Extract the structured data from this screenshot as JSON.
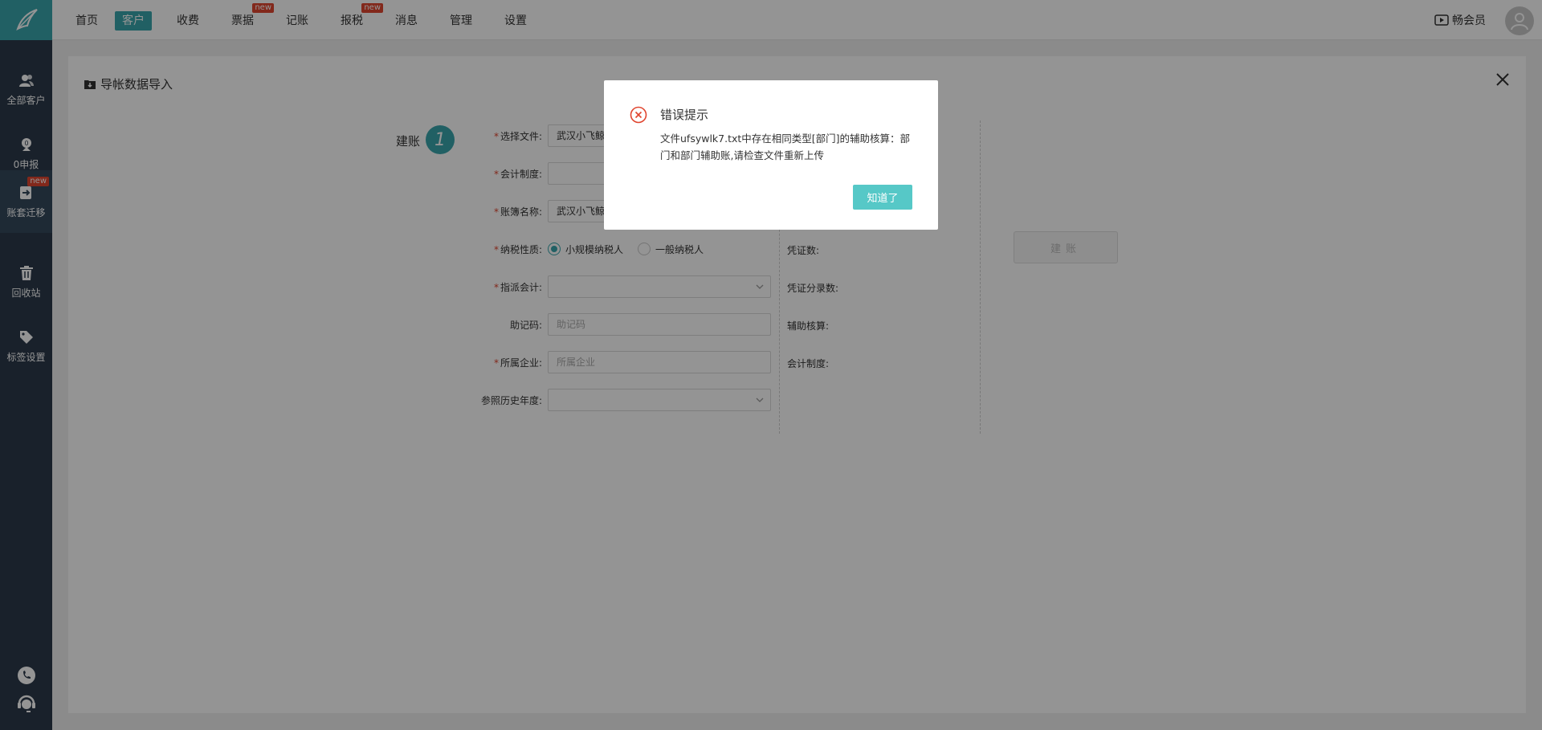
{
  "sidebar": {
    "items": [
      {
        "label": "全部客户",
        "icon": "users-icon"
      },
      {
        "label": "0申报",
        "icon": "zero-report-icon"
      },
      {
        "label": "账套迁移",
        "icon": "migrate-icon",
        "badge": "new",
        "active": true
      },
      {
        "label": "回收站",
        "icon": "trash-icon"
      },
      {
        "label": "标签设置",
        "icon": "tag-icon"
      }
    ]
  },
  "topnav": {
    "items": [
      {
        "label": "首页"
      },
      {
        "label": "客户",
        "active": true
      },
      {
        "label": "收费"
      },
      {
        "label": "票据",
        "badge": "new"
      },
      {
        "label": "记账"
      },
      {
        "label": "报税",
        "badge": "new"
      },
      {
        "label": "消息"
      },
      {
        "label": "管理"
      },
      {
        "label": "设置"
      }
    ],
    "member_label": "畅会员"
  },
  "panel": {
    "title": "导帐数据导入",
    "step_label": "建账",
    "step_number": "1",
    "form": {
      "select_file": {
        "label": "选择文件:",
        "value": "武汉小飞鲸"
      },
      "accounting_system": {
        "label": "会计制度:",
        "value": ""
      },
      "book_name": {
        "label": "账簿名称:",
        "value": "武汉小飞鲸"
      },
      "taxpayer_type": {
        "label": "纳税性质:",
        "options": [
          "小规模纳税人",
          "一般纳税人"
        ],
        "selected": "小规模纳税人"
      },
      "assigned_accountant": {
        "label": "指派会计:",
        "value": ""
      },
      "mnemonic": {
        "label": "助记码:",
        "placeholder": "助记码"
      },
      "company": {
        "label": "所属企业:",
        "placeholder": "所属企业"
      },
      "history_year": {
        "label": "参照历史年度:",
        "value": ""
      }
    },
    "info": {
      "voucher_count": "凭证数:",
      "voucher_entries": "凭证分录数:",
      "aux_accounting": "辅助核算:",
      "accounting_system": "会计制度:"
    },
    "build_button": "建账"
  },
  "modal": {
    "title": "错误提示",
    "message": "文件ufsywlk7.txt中存在相同类型[部门]的辅助核算：部门和部门辅助账,请检查文件重新上传",
    "confirm": "知道了"
  },
  "colors": {
    "accent": "#3aa6ad",
    "error": "#e0452f",
    "sidebar": "#2b3a4a",
    "modal_button": "#56c8c7"
  }
}
